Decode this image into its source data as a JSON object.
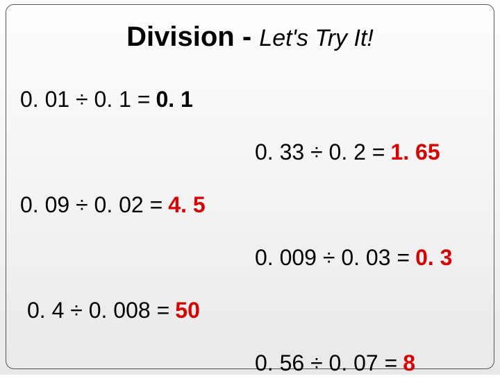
{
  "title": {
    "main": "Division - ",
    "sub": "Let's Try It!"
  },
  "rows": {
    "l1": {
      "expr": "0. 01 ÷ 0. 1 = ",
      "ans": "0. 1"
    },
    "r1": {
      "expr": "0. 33 ÷ 0. 2 = ",
      "ans": "1. 65"
    },
    "l2": {
      "expr": "0. 09 ÷ 0. 02 = ",
      "ans": "4. 5"
    },
    "r2": {
      "expr": "0. 009 ÷ 0. 03 = ",
      "ans": "0. 3"
    },
    "l3": {
      "expr": "0. 4 ÷ 0. 008 = ",
      "ans": "50"
    },
    "r3": {
      "expr": "0. 56 ÷ 0. 07 =  ",
      "ans": "8"
    }
  }
}
